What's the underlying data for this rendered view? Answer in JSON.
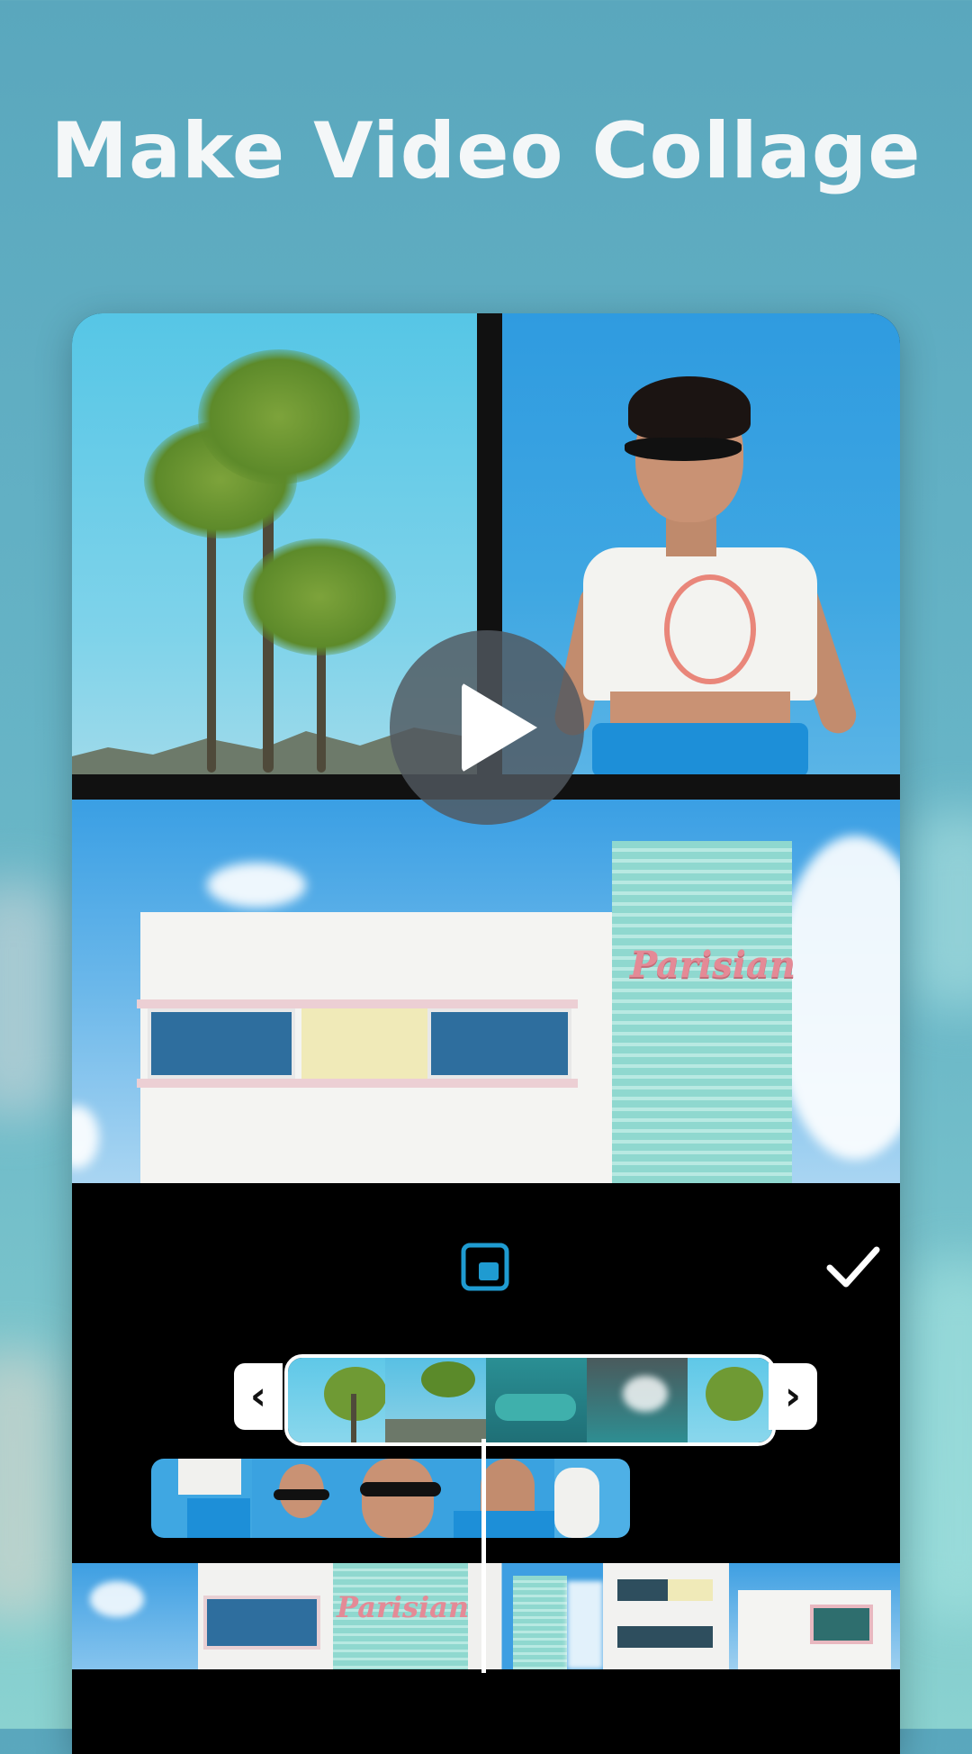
{
  "headline": "Make Video Collage",
  "colors": {
    "background": "#62b0c4",
    "editor_bg": "#000000",
    "accent": "#1f9bd1",
    "headline_text": "#f4f7f8"
  },
  "collage": {
    "cells": [
      {
        "name": "palm-trees",
        "subject": "palm trees against blue sky"
      },
      {
        "name": "woman-sunglasses",
        "subject": "woman in sunglasses and white tee"
      },
      {
        "name": "parisian-building",
        "subject": "white building with Parisian sign"
      }
    ],
    "building_sign_text": "Parisian",
    "play_icon": "play-icon"
  },
  "toolbar": {
    "pip_icon": "picture-in-picture-icon",
    "confirm_icon": "checkmark-icon"
  },
  "timeline": {
    "handle_left_glyph": "‹",
    "handle_right_glyph": "›",
    "tracks": [
      {
        "name": "palms-and-car-clip",
        "selected": true
      },
      {
        "name": "woman-clip",
        "selected": false
      },
      {
        "name": "building-clip",
        "selected": false
      }
    ]
  }
}
